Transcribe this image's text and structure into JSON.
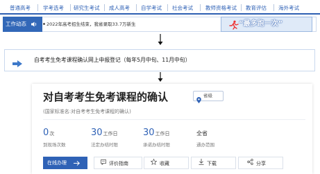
{
  "nav": {
    "items": [
      "普通高考",
      "学考选考",
      "研究生考试",
      "成人高考",
      "自学考试",
      "社会考试",
      "教师资格考试",
      "教育评估",
      "海外考试"
    ]
  },
  "news": {
    "tag": "工作动态",
    "item": "2022年高考招生结束，我省录取33.7万新生",
    "banner": "“最多跑一次”"
  },
  "step": {
    "text": "自考考生免考课程确认网上申报登记（每年5月中旬、11月中旬）"
  },
  "card": {
    "title": "对自考考生免考课程的确认",
    "region": "省级",
    "subtitle": "(国家标准名:对自考考生免考课程的确认)",
    "stats": [
      {
        "value": "0",
        "unit": "次",
        "label": "到现场次数"
      },
      {
        "value": "30",
        "unit": "工作日",
        "label": "法定办结时限"
      },
      {
        "value": "30",
        "unit": "工作日",
        "label": "承诺办结时限"
      },
      {
        "value": "全省",
        "unit": "",
        "label": "通办范围"
      }
    ],
    "buttons": {
      "online": "在线办理",
      "review": "评价指南",
      "favorite": "收藏",
      "download": "下载",
      "share": "分享"
    }
  },
  "colors": {
    "primary": "#2f62b6",
    "nav_line": "#2d5fb2"
  }
}
